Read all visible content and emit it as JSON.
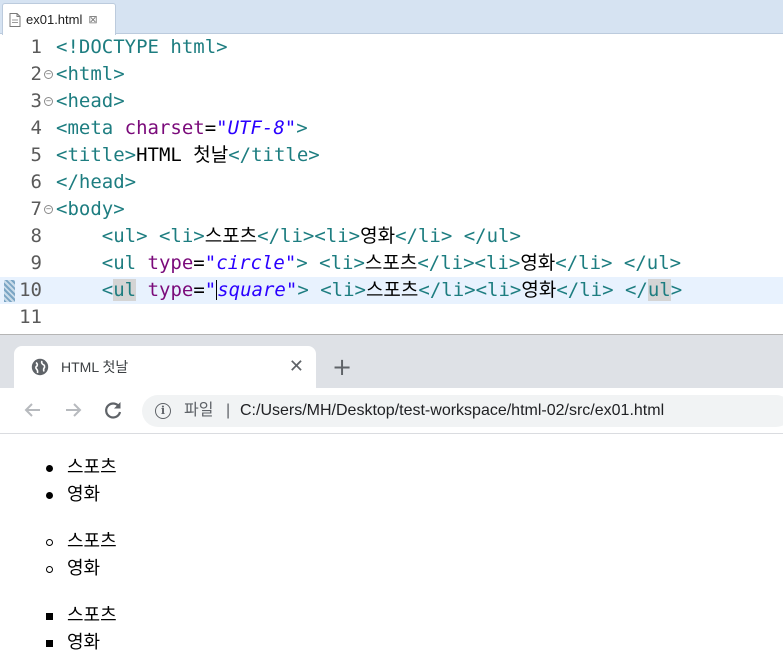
{
  "editor": {
    "tab_label": "ex01.html",
    "tab_close": "⊠",
    "lines": [
      {
        "num": "1",
        "fold": false,
        "tokens": [
          [
            "t",
            "<!DOCTYPE html>"
          ]
        ]
      },
      {
        "num": "2",
        "fold": true,
        "tokens": [
          [
            "t",
            "<html>"
          ]
        ]
      },
      {
        "num": "3",
        "fold": true,
        "tokens": [
          [
            "t",
            "<head>"
          ]
        ]
      },
      {
        "num": "4",
        "fold": false,
        "tokens": [
          [
            "t",
            "<meta "
          ],
          [
            "a",
            "charset"
          ],
          [
            "p",
            "="
          ],
          [
            "v",
            "\"UTF-8\""
          ],
          [
            "t",
            ">"
          ]
        ]
      },
      {
        "num": "5",
        "fold": false,
        "tokens": [
          [
            "t",
            "<title>"
          ],
          [
            "p",
            "HTML 첫날"
          ],
          [
            "t",
            "</title>"
          ]
        ]
      },
      {
        "num": "6",
        "fold": false,
        "tokens": [
          [
            "t",
            "</head>"
          ]
        ]
      },
      {
        "num": "7",
        "fold": true,
        "tokens": [
          [
            "t",
            "<body>"
          ]
        ]
      },
      {
        "num": "8",
        "fold": false,
        "tokens": [
          [
            "p",
            "    "
          ],
          [
            "t",
            "<ul> <li>"
          ],
          [
            "p",
            "스포츠"
          ],
          [
            "t",
            "</li><li>"
          ],
          [
            "p",
            "영화"
          ],
          [
            "t",
            "</li> </ul>"
          ]
        ]
      },
      {
        "num": "9",
        "fold": false,
        "tokens": [
          [
            "p",
            "    "
          ],
          [
            "t",
            "<ul "
          ],
          [
            "a",
            "type"
          ],
          [
            "p",
            "="
          ],
          [
            "v",
            "\"circle\""
          ],
          [
            "t",
            "> <li>"
          ],
          [
            "p",
            "스포츠"
          ],
          [
            "t",
            "</li><li>"
          ],
          [
            "p",
            "영화"
          ],
          [
            "t",
            "</li> </ul>"
          ]
        ]
      },
      {
        "num": "10",
        "fold": false,
        "current": true,
        "tokens": [
          [
            "p",
            "    "
          ],
          [
            "t",
            "<"
          ],
          [
            "th",
            "ul"
          ],
          [
            "t",
            " "
          ],
          [
            "a",
            "type"
          ],
          [
            "p",
            "="
          ],
          [
            "vc",
            "\"square\""
          ],
          [
            "t",
            "> <li>"
          ],
          [
            "p",
            "스포츠"
          ],
          [
            "t",
            "</li><li>"
          ],
          [
            "p",
            "영화"
          ],
          [
            "t",
            "</li> </"
          ],
          [
            "th",
            "ul"
          ],
          [
            "t",
            ">"
          ]
        ]
      },
      {
        "num": "11",
        "fold": false,
        "tokens": []
      }
    ]
  },
  "browser": {
    "tab_title": "HTML 첫날",
    "tab_close": "✕",
    "new_tab": "+",
    "info_icon": "i",
    "omnibox_label": "파일",
    "omnibox_sep": "|",
    "url": "C:/Users/MH/Desktop/test-workspace/html-02/src/ex01.html",
    "lists": [
      {
        "type": "disc",
        "items": [
          "스포츠",
          "영화"
        ]
      },
      {
        "type": "circle",
        "items": [
          "스포츠",
          "영화"
        ]
      },
      {
        "type": "square",
        "items": [
          "스포츠",
          "영화"
        ]
      }
    ]
  },
  "colors": {
    "tag": "#1d7d80",
    "attribute": "#7a0a7a",
    "value": "#2a00ff",
    "current_line": "#e8f2fe",
    "tabstrip": "#dee1e6"
  }
}
